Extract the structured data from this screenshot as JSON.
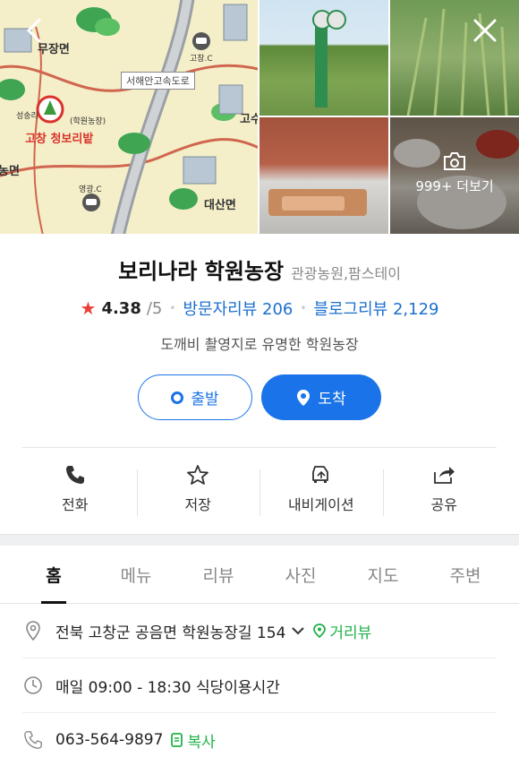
{
  "gallery": {
    "map_labels": {
      "town_top": "무장면",
      "highway": "서해안고속도로",
      "ic_top": "고창.C",
      "village": "성송리",
      "farm_tag": "(학원농장)",
      "festival": "고창 청보리밭",
      "ic_bottom": "영광.C",
      "town_bottom": "대산면",
      "edge_left": "농면",
      "edge_right": "고수"
    },
    "more_label": "999+ 더보기"
  },
  "place": {
    "name": "보리나라 학원농장",
    "category": "관광농원,팜스테이",
    "rating": "4.38",
    "rating_max": "/5",
    "visitor_reviews": "방문자리뷰 206",
    "blog_reviews": "블로그리뷰 2,129",
    "description": "도깨비 촬영지로 유명한 학원농장"
  },
  "buttons": {
    "departure": "출발",
    "arrival": "도착"
  },
  "actions": [
    {
      "label": "전화",
      "icon": "phone-icon"
    },
    {
      "label": "저장",
      "icon": "star-outline-icon"
    },
    {
      "label": "내비게이션",
      "icon": "car-nav-icon"
    },
    {
      "label": "공유",
      "icon": "share-icon"
    }
  ],
  "tabs": [
    "홈",
    "메뉴",
    "리뷰",
    "사진",
    "지도",
    "주변"
  ],
  "active_tab": "홈",
  "details": {
    "address": "전북 고창군 공음면 학원농장길 154",
    "street_view": "거리뷰",
    "hours": "매일 09:00 - 18:30 식당이용시간",
    "phone": "063-564-9897",
    "copy": "복사"
  },
  "colors": {
    "accent_blue": "#1a73e8",
    "link_blue": "#1c6fce",
    "star_red": "#e8413b",
    "green": "#1db347"
  }
}
